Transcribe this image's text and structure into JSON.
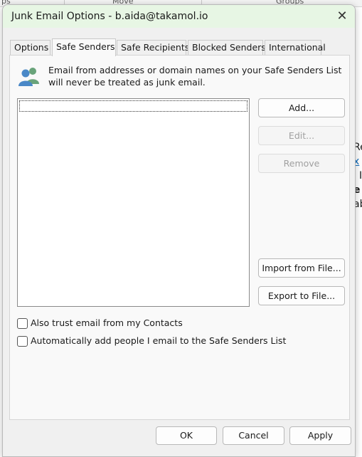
{
  "background": {
    "ribbon_items": [
      "ps",
      "Move",
      "Groups"
    ],
    "peek_lines": [
      "Re",
      "x",
      "I",
      "e",
      "ab"
    ]
  },
  "dialog": {
    "title": "Junk Email Options - b.aida@takamol.io",
    "close_glyph": "✕",
    "tabs": [
      "Options",
      "Safe Senders",
      "Safe Recipients",
      "Blocked Senders",
      "International"
    ],
    "active_tab": "Safe Senders",
    "description": "Email from addresses or domain names on your Safe Senders List will never be treated as junk email.",
    "list_items": [],
    "buttons": {
      "add": "Add...",
      "edit": "Edit...",
      "remove": "Remove",
      "import": "Import from File...",
      "export": "Export to File..."
    },
    "checkboxes": [
      {
        "label": "Also trust email from my Contacts",
        "checked": false
      },
      {
        "label": "Automatically add people I email to the Safe Senders List",
        "checked": false
      }
    ],
    "footer": {
      "ok": "OK",
      "cancel": "Cancel",
      "apply": "Apply"
    }
  },
  "colors": {
    "titlebar_bg": "#e7f6e4",
    "link_blue": "#0f6cbd",
    "icon_blue": "#4a88c7",
    "icon_green": "#69a37a"
  },
  "icons": {
    "close": "close-icon",
    "safe_senders": "people-icon"
  }
}
